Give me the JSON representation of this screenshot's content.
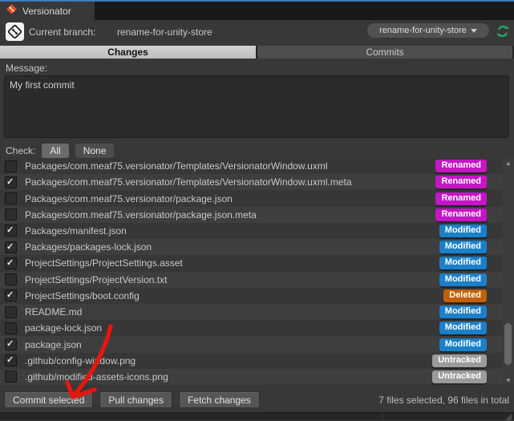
{
  "window": {
    "tab_title": "Versionator"
  },
  "branch_bar": {
    "label": "Current branch:",
    "value": "rename-for-unity-store",
    "dropdown_value": "rename-for-unity-store",
    "refresh_color": "#27a567"
  },
  "tabs": {
    "changes": "Changes",
    "commits": "Commits",
    "active": "Changes"
  },
  "message": {
    "label": "Message:",
    "value": "My first commit"
  },
  "check_bar": {
    "label": "Check:",
    "all": "All",
    "none": "None"
  },
  "status_colors": {
    "Renamed": "#c516c5",
    "Modified": "#1b80c9",
    "Deleted": "#c26000",
    "Untracked": "#9b9b9b"
  },
  "files": [
    {
      "checked": false,
      "path": "Packages/com.meaf75.versionator/Templates/VersionatorWindow.uxml",
      "status": "Renamed"
    },
    {
      "checked": true,
      "path": "Packages/com.meaf75.versionator/Templates/VersionatorWindow.uxml.meta",
      "status": "Renamed"
    },
    {
      "checked": false,
      "path": "Packages/com.meaf75.versionator/package.json",
      "status": "Renamed"
    },
    {
      "checked": false,
      "path": "Packages/com.meaf75.versionator/package.json.meta",
      "status": "Renamed"
    },
    {
      "checked": true,
      "path": "Packages/manifest.json",
      "status": "Modified"
    },
    {
      "checked": true,
      "path": "Packages/packages-lock.json",
      "status": "Modified"
    },
    {
      "checked": true,
      "path": "ProjectSettings/ProjectSettings.asset",
      "status": "Modified"
    },
    {
      "checked": false,
      "path": "ProjectSettings/ProjectVersion.txt",
      "status": "Modified"
    },
    {
      "checked": true,
      "path": "ProjectSettings/boot.config",
      "status": "Deleted"
    },
    {
      "checked": false,
      "path": "README.md",
      "status": "Modified"
    },
    {
      "checked": false,
      "path": "package-lock.json",
      "status": "Modified"
    },
    {
      "checked": true,
      "path": "package.json",
      "status": "Modified"
    },
    {
      "checked": true,
      "path": ".github/config-window.png",
      "status": "Untracked"
    },
    {
      "checked": false,
      "path": ".github/modified-assets-icons.png",
      "status": "Untracked"
    }
  ],
  "footer": {
    "commit": "Commit selected",
    "pull": "Pull changes",
    "fetch": "Fetch changes",
    "summary": "7 files selected, 96 files in total"
  },
  "annotation": {
    "arrow_color": "#e3170d"
  }
}
